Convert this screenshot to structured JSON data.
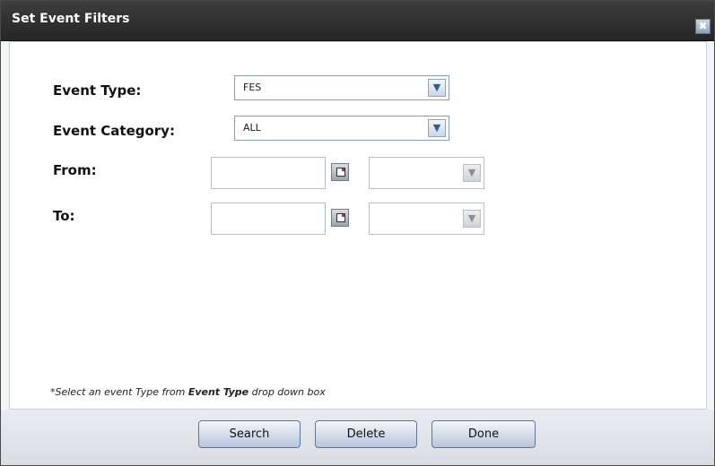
{
  "dialog": {
    "title": "Set Event Filters",
    "close_glyph": "✖"
  },
  "form": {
    "event_type": {
      "label": "Event Type:",
      "value": "FES"
    },
    "event_category": {
      "label": "Event Category:",
      "value": "ALL"
    },
    "from": {
      "label": "From:",
      "date_value": "",
      "time_value": ""
    },
    "to": {
      "label": "To:",
      "date_value": "",
      "time_value": ""
    }
  },
  "note": {
    "prefix": "*Select an event Type from ",
    "emphasis": "Event Type",
    "suffix": " drop down box"
  },
  "buttons": {
    "search": "Search",
    "delete": "Delete",
    "done": "Done"
  },
  "icons": {
    "close": "close-icon",
    "dropdown": "chevron-down-icon",
    "calendar": "calendar-icon"
  }
}
